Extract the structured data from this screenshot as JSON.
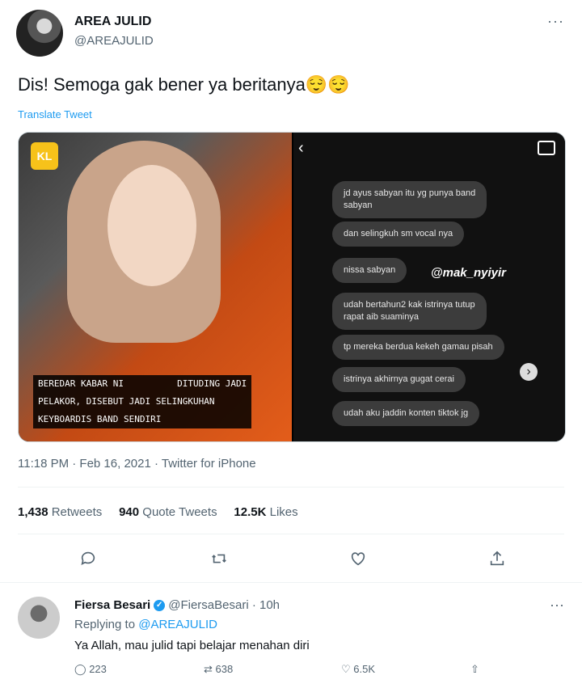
{
  "tweet": {
    "name": "AREA JULID",
    "handle": "@AREAJULID",
    "more": "···",
    "text": "Dis! Semoga gak bener ya beritanya😌😌",
    "translate": "Translate Tweet",
    "media": {
      "logo": "KL",
      "caption": "BEREDAR KABAR NI          DITUDING JADI\nPELAKOR, DISEBUT JADI SELINGKUHAN\nKEYBOARDIS BAND SENDIRI",
      "watermark": "@mak_nyiyir",
      "chat": [
        "jd ayus sabyan itu yg punya band\nsabyan",
        "dan selingkuh sm vocal nya",
        "nissa sabyan",
        "udah bertahun2 kak istrinya tutup\nrapat aib suaminya",
        "tp mereka berdua kekeh gamau pisah",
        "istrinya akhirnya gugat cerai",
        "udah aku jaddin konten tiktok jg"
      ]
    },
    "time": "11:18 PM · Feb 16, 2021 · Twitter for iPhone",
    "stats": {
      "retweets_num": "1,438",
      "retweets_label": " Retweets",
      "quotes_num": "940",
      "quotes_label": " Quote Tweets",
      "likes_num": "12.5K",
      "likes_label": " Likes"
    }
  },
  "reply": {
    "name": "Fiersa Besari",
    "handle": "@FiersaBesari · 10h",
    "replying_prefix": "Replying to ",
    "replying_to": "@AREAJULID",
    "text": "Ya Allah, mau julid tapi belajar menahan diri",
    "replies": "223",
    "retweets": "638",
    "likes": "6.5K"
  }
}
